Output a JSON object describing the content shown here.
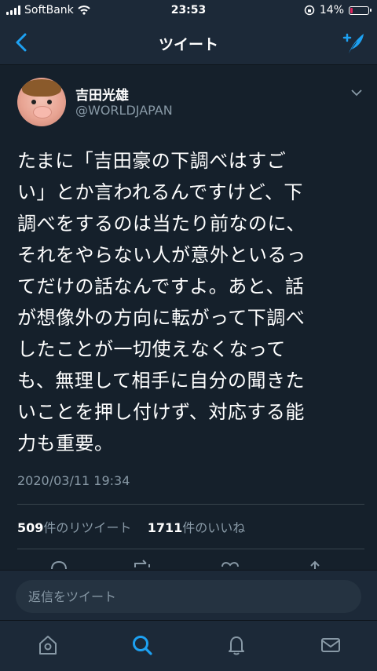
{
  "status_bar": {
    "carrier": "SoftBank",
    "time": "23:53",
    "battery": "14%"
  },
  "nav": {
    "title": "ツイート"
  },
  "tweet": {
    "author_name": "吉田光雄",
    "author_handle": "@WORLDJAPAN",
    "lines": [
      "たまに「吉田豪の下調べはすご",
      "い」とか言われるんですけど、下",
      "調べをするのは当たり前なのに、",
      "それをやらない人が意外といるっ",
      "てだけの話なんですよ。あと、話",
      "が想像外の方向に転がって下調べ",
      "したことが一切使えなくなって",
      "も、無理して相手に自分の聞きた",
      "いことを押し付けず、対応する能",
      "力も重要。"
    ],
    "timestamp": "2020/03/11 19:34",
    "retweet_count": "509",
    "retweet_label": "件のリツイート",
    "like_count": "1711",
    "like_label": "件のいいね"
  },
  "reply": {
    "placeholder": "返信をツイート"
  },
  "tabs": [
    "home-icon",
    "search-icon",
    "notifications-icon",
    "messages-icon"
  ],
  "colors": {
    "background": "#15202b",
    "bar": "#1c2938",
    "accent": "#1da1f2",
    "muted": "#8899a6"
  }
}
